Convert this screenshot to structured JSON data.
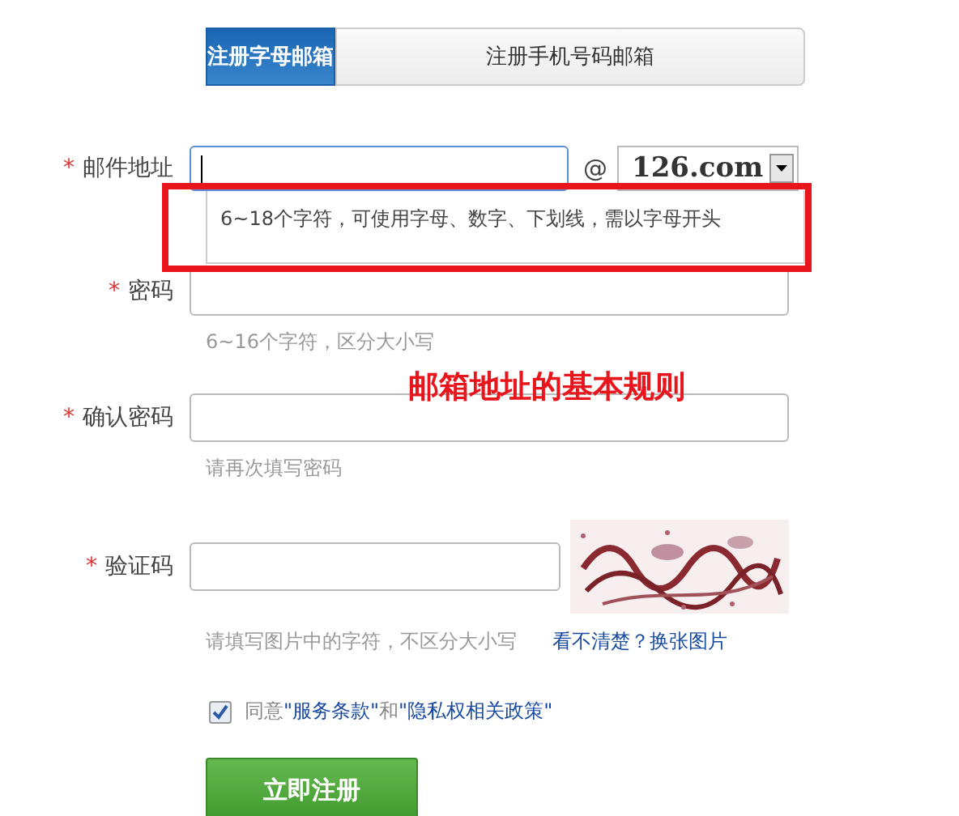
{
  "tabs": [
    {
      "label": "注册字母邮箱",
      "selected": true
    },
    {
      "label": "注册手机号码邮箱",
      "selected": false
    }
  ],
  "fields": [
    {
      "kind": "email",
      "label": "邮件地址",
      "required_mark": "*",
      "focused": true,
      "at": "@",
      "domain": "126.com",
      "tip": "6~18个字符，可使用字母、数字、下划线，需以字母开头"
    },
    {
      "kind": "text",
      "label": "密码",
      "required_mark": "*",
      "focused": false,
      "hint": "6~16个字符，区分大小写"
    },
    {
      "kind": "text",
      "label": "确认密码",
      "required_mark": "*",
      "focused": false,
      "hint": "请再次填写密码"
    },
    {
      "kind": "captcha",
      "label": "验证码",
      "required_mark": "*",
      "focused": false,
      "hint": "请填写图片中的字符，不区分大小写",
      "refresh_link": "看不清楚？换张图片"
    }
  ],
  "agreement": {
    "checked": true,
    "parts": [
      {
        "kind": "plain",
        "text": "同意"
      },
      {
        "kind": "link",
        "text": "\"服务条款\""
      },
      {
        "kind": "plain",
        "text": "和"
      },
      {
        "kind": "link",
        "text": "\"隐私权相关政策\""
      }
    ]
  },
  "submit": "立即注册",
  "annotation": "邮箱地址的基本规则"
}
